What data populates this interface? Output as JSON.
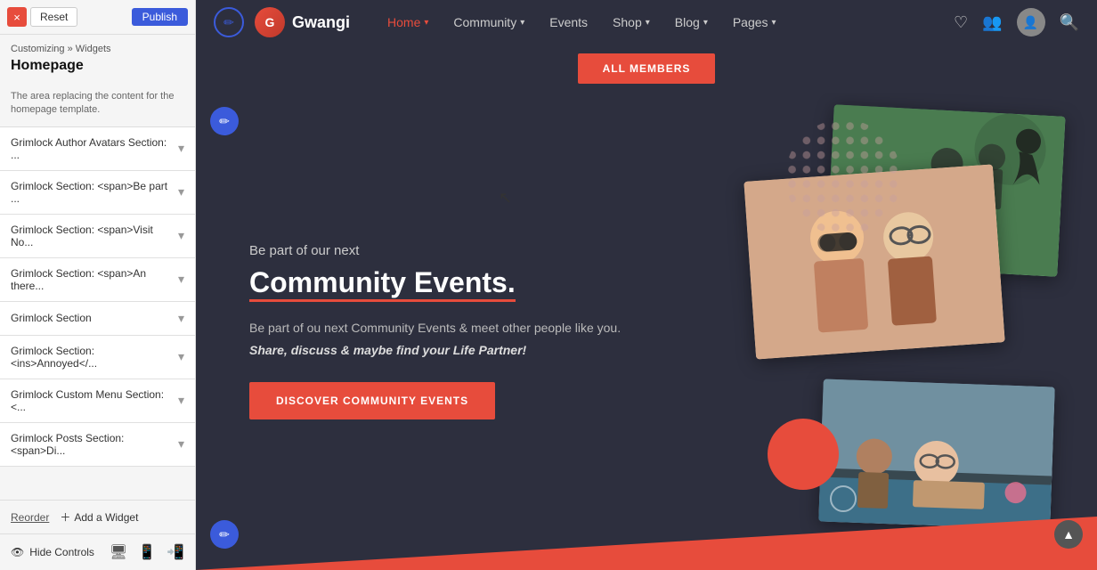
{
  "sidebar": {
    "close_label": "×",
    "reset_label": "Reset",
    "publish_label": "Publish",
    "breadcrumb_customizing": "Customizing",
    "breadcrumb_sep": "»",
    "breadcrumb_widgets": "Widgets",
    "page_title": "Homepage",
    "info_text": "The area replacing the content for the homepage template.",
    "items": [
      {
        "label": "Grimlock Author Avatars Section: ..."
      },
      {
        "label": "Grimlock Section: <span>Be part ..."
      },
      {
        "label": "Grimlock Section: <span>Visit No..."
      },
      {
        "label": "Grimlock Section: <span>An there..."
      },
      {
        "label": "Grimlock Section"
      },
      {
        "label": "Grimlock Section: <ins>Annoyed</..."
      },
      {
        "label": "Grimlock Custom Menu Section: <..."
      },
      {
        "label": "Grimlock Posts Section: <span>Di..."
      }
    ],
    "reorder_label": "Reorder",
    "add_widget_label": "Add a Widget",
    "hide_controls_label": "Hide Controls"
  },
  "nav": {
    "brand": "Gwangi",
    "home_label": "Home",
    "community_label": "Community",
    "events_label": "Events",
    "shop_label": "Shop",
    "blog_label": "Blog",
    "pages_label": "Pages"
  },
  "all_members_btn": "ALL MEMBERS",
  "hero": {
    "subtitle": "Be part of our next",
    "title_line1": "Community Events.",
    "desc1": "Be part of ou next Community Events & meet other people like you.",
    "desc2": "Share, discuss & maybe find your Life Partner!",
    "cta_label": "DISCOVER COMMUNITY EVENTS"
  },
  "colors": {
    "accent": "#e74c3c",
    "nav_bg": "#2d2f3e",
    "sidebar_bg": "#f5f5f5"
  }
}
